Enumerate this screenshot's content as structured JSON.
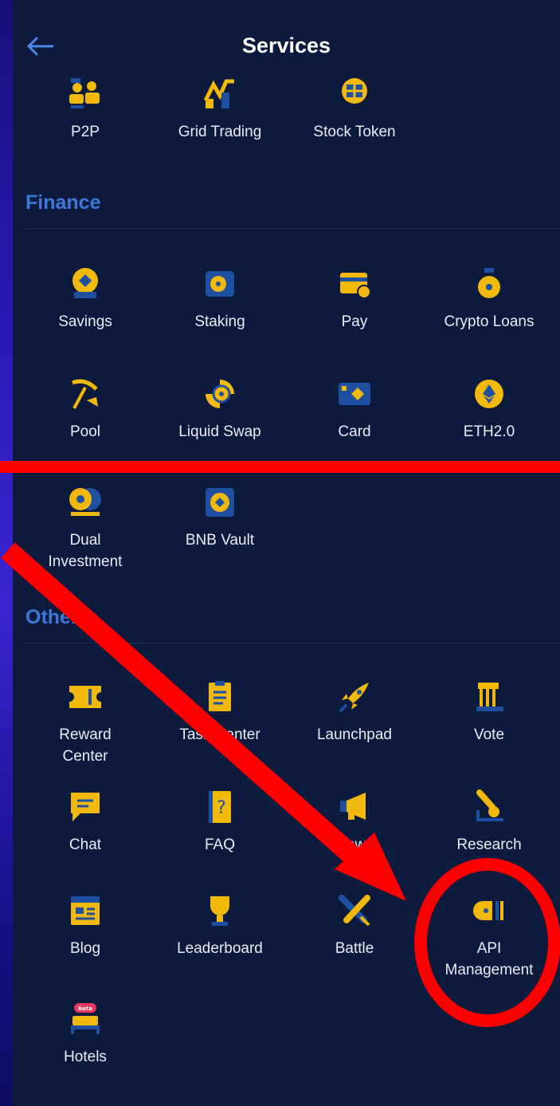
{
  "header": {
    "title": "Services"
  },
  "top_items": [
    {
      "label": "P2P",
      "icon": "p2p-icon"
    },
    {
      "label": "Grid Trading",
      "icon": "grid-trading-icon"
    },
    {
      "label": "Stock Token",
      "icon": "stock-token-icon"
    }
  ],
  "finance": {
    "title": "Finance",
    "items": [
      {
        "label": "Savings",
        "icon": "savings-icon"
      },
      {
        "label": "Staking",
        "icon": "staking-icon"
      },
      {
        "label": "Pay",
        "icon": "pay-icon"
      },
      {
        "label": "Crypto Loans",
        "icon": "crypto-loans-icon"
      },
      {
        "label": "Pool",
        "icon": "pool-icon"
      },
      {
        "label": "Liquid Swap",
        "icon": "liquid-swap-icon"
      },
      {
        "label": "Card",
        "icon": "card-icon"
      },
      {
        "label": "ETH2.0",
        "icon": "eth-icon"
      },
      {
        "label": "Dual",
        "label2": "Investment",
        "icon": "dual-investment-icon"
      },
      {
        "label": "BNB Vault",
        "icon": "bnb-vault-icon"
      }
    ]
  },
  "others": {
    "title": "Others",
    "items": [
      {
        "label": "Reward",
        "label2": "Center",
        "icon": "reward-center-icon"
      },
      {
        "label": "Task Center",
        "icon": "task-center-icon"
      },
      {
        "label": "Launchpad",
        "icon": "rocket-icon"
      },
      {
        "label": "Vote",
        "icon": "vote-icon"
      },
      {
        "label": "Chat",
        "icon": "chat-icon"
      },
      {
        "label": "FAQ",
        "icon": "faq-icon"
      },
      {
        "label": "News",
        "icon": "megaphone-icon"
      },
      {
        "label": "Research",
        "icon": "microscope-icon"
      },
      {
        "label": "Blog",
        "icon": "blog-icon"
      },
      {
        "label": "Leaderboard",
        "icon": "trophy-icon"
      },
      {
        "label": "Battle",
        "icon": "battle-icon"
      },
      {
        "label": "API",
        "label2": "Management",
        "icon": "plug-icon"
      },
      {
        "label": "Hotels",
        "icon": "bed-icon",
        "badge": "Beta"
      }
    ]
  },
  "colors": {
    "background": "#0b1a3d",
    "icon_yellow": "#f0b90b",
    "icon_blue": "#1e4fa0",
    "section_title": "#3d78d8",
    "annotation_red": "#ff0000"
  }
}
